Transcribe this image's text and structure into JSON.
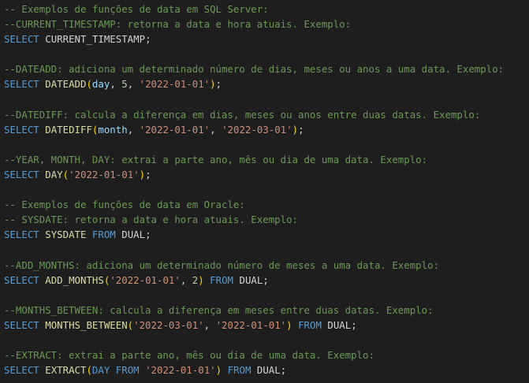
{
  "editor": {
    "language": "sql",
    "colors": {
      "background": "#1e1e1e",
      "comment": "#6a9955",
      "keyword": "#569cd6",
      "function": "#dcdcaa",
      "string": "#ce9178",
      "number": "#b5cea8",
      "identifier": "#9cdcfe",
      "plain": "#d4d4d4",
      "bracket": "#ffd700"
    },
    "lines": [
      [
        {
          "t": "comment",
          "v": "-- Exemplos de funções de data em SQL Server:"
        }
      ],
      [
        {
          "t": "comment",
          "v": "--CURRENT_TIMESTAMP: retorna a data e hora atuais. Exemplo:"
        }
      ],
      [
        {
          "t": "keyword",
          "v": "SELECT"
        },
        {
          "t": "plain",
          "v": " "
        },
        {
          "t": "plain",
          "v": "CURRENT_TIMESTAMP"
        },
        {
          "t": "plain",
          "v": ";"
        }
      ],
      [],
      [
        {
          "t": "comment",
          "v": "--DATEADD: adiciona um determinado número de dias, meses ou anos a uma data. Exemplo:"
        }
      ],
      [
        {
          "t": "keyword",
          "v": "SELECT"
        },
        {
          "t": "plain",
          "v": " "
        },
        {
          "t": "function",
          "v": "DATEADD"
        },
        {
          "t": "bracket",
          "v": "("
        },
        {
          "t": "identifier",
          "v": "day"
        },
        {
          "t": "plain",
          "v": ", "
        },
        {
          "t": "number",
          "v": "5"
        },
        {
          "t": "plain",
          "v": ", "
        },
        {
          "t": "string",
          "v": "'2022-01-01'"
        },
        {
          "t": "bracket",
          "v": ")"
        },
        {
          "t": "plain",
          "v": ";"
        }
      ],
      [],
      [
        {
          "t": "comment",
          "v": "--DATEDIFF: calcula a diferença em dias, meses ou anos entre duas datas. Exemplo:"
        }
      ],
      [
        {
          "t": "keyword",
          "v": "SELECT"
        },
        {
          "t": "plain",
          "v": " "
        },
        {
          "t": "function",
          "v": "DATEDIFF"
        },
        {
          "t": "bracket",
          "v": "("
        },
        {
          "t": "identifier",
          "v": "month"
        },
        {
          "t": "plain",
          "v": ", "
        },
        {
          "t": "string",
          "v": "'2022-01-01'"
        },
        {
          "t": "plain",
          "v": ", "
        },
        {
          "t": "string",
          "v": "'2022-03-01'"
        },
        {
          "t": "bracket",
          "v": ")"
        },
        {
          "t": "plain",
          "v": ";"
        }
      ],
      [],
      [
        {
          "t": "comment",
          "v": "--YEAR, MONTH, DAY: extrai a parte ano, mês ou dia de uma data. Exemplo:"
        }
      ],
      [
        {
          "t": "keyword",
          "v": "SELECT"
        },
        {
          "t": "plain",
          "v": " "
        },
        {
          "t": "function",
          "v": "DAY"
        },
        {
          "t": "bracket",
          "v": "("
        },
        {
          "t": "string",
          "v": "'2022-01-01'"
        },
        {
          "t": "bracket",
          "v": ")"
        },
        {
          "t": "plain",
          "v": ";"
        }
      ],
      [],
      [
        {
          "t": "comment",
          "v": "-- Exemplos de funções de data em Oracle:"
        }
      ],
      [
        {
          "t": "comment",
          "v": "-- SYSDATE: retorna a data e hora atuais. Exemplo:"
        }
      ],
      [
        {
          "t": "keyword",
          "v": "SELECT"
        },
        {
          "t": "plain",
          "v": " "
        },
        {
          "t": "function",
          "v": "SYSDATE"
        },
        {
          "t": "plain",
          "v": " "
        },
        {
          "t": "keyword",
          "v": "FROM"
        },
        {
          "t": "plain",
          "v": " "
        },
        {
          "t": "plain",
          "v": "DUAL"
        },
        {
          "t": "plain",
          "v": ";"
        }
      ],
      [],
      [
        {
          "t": "comment",
          "v": "--ADD_MONTHS: adiciona um determinado número de meses a uma data. Exemplo:"
        }
      ],
      [
        {
          "t": "keyword",
          "v": "SELECT"
        },
        {
          "t": "plain",
          "v": " "
        },
        {
          "t": "function",
          "v": "ADD_MONTHS"
        },
        {
          "t": "bracket",
          "v": "("
        },
        {
          "t": "string",
          "v": "'2022-01-01'"
        },
        {
          "t": "plain",
          "v": ", "
        },
        {
          "t": "number",
          "v": "2"
        },
        {
          "t": "bracket",
          "v": ")"
        },
        {
          "t": "plain",
          "v": " "
        },
        {
          "t": "keyword",
          "v": "FROM"
        },
        {
          "t": "plain",
          "v": " "
        },
        {
          "t": "plain",
          "v": "DUAL"
        },
        {
          "t": "plain",
          "v": ";"
        }
      ],
      [],
      [
        {
          "t": "comment",
          "v": "--MONTHS_BETWEEN: calcula a diferença em meses entre duas datas. Exemplo:"
        }
      ],
      [
        {
          "t": "keyword",
          "v": "SELECT"
        },
        {
          "t": "plain",
          "v": " "
        },
        {
          "t": "function",
          "v": "MONTHS_BETWEEN"
        },
        {
          "t": "bracket",
          "v": "("
        },
        {
          "t": "string",
          "v": "'2022-03-01'"
        },
        {
          "t": "plain",
          "v": ", "
        },
        {
          "t": "string",
          "v": "'2022-01-01'"
        },
        {
          "t": "bracket",
          "v": ")"
        },
        {
          "t": "plain",
          "v": " "
        },
        {
          "t": "keyword",
          "v": "FROM"
        },
        {
          "t": "plain",
          "v": " "
        },
        {
          "t": "plain",
          "v": "DUAL"
        },
        {
          "t": "plain",
          "v": ";"
        }
      ],
      [],
      [
        {
          "t": "comment",
          "v": "--EXTRACT: extrai a parte ano, mês ou dia de uma data. Exemplo:"
        }
      ],
      [
        {
          "t": "keyword",
          "v": "SELECT"
        },
        {
          "t": "plain",
          "v": " "
        },
        {
          "t": "function",
          "v": "EXTRACT"
        },
        {
          "t": "bracket",
          "v": "("
        },
        {
          "t": "keyword",
          "v": "DAY"
        },
        {
          "t": "plain",
          "v": " "
        },
        {
          "t": "keyword",
          "v": "FROM"
        },
        {
          "t": "plain",
          "v": " "
        },
        {
          "t": "string",
          "v": "'2022-01-01'"
        },
        {
          "t": "bracket",
          "v": ")"
        },
        {
          "t": "plain",
          "v": " "
        },
        {
          "t": "keyword",
          "v": "FROM"
        },
        {
          "t": "plain",
          "v": " "
        },
        {
          "t": "plain",
          "v": "DUAL"
        },
        {
          "t": "plain",
          "v": ";"
        }
      ]
    ]
  }
}
